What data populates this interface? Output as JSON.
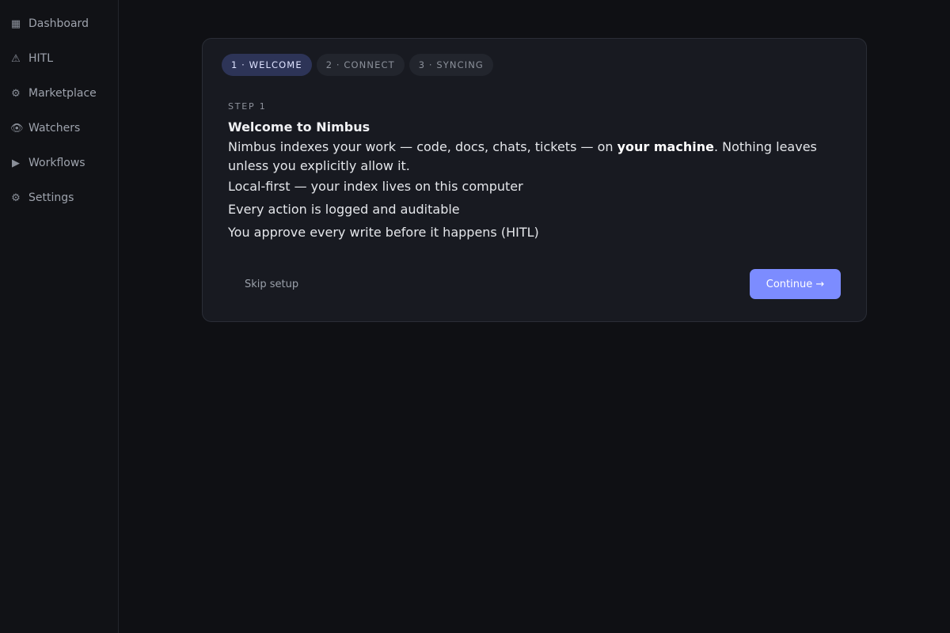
{
  "sidebar": {
    "items": [
      {
        "icon": "▦",
        "label": "Dashboard"
      },
      {
        "icon": "⚠",
        "label": "HITL"
      },
      {
        "icon": "⚙",
        "label": "Marketplace"
      },
      {
        "icon": "👁",
        "label": "Watchers"
      },
      {
        "icon": "▶",
        "label": "Workflows"
      },
      {
        "icon": "⚙",
        "label": "Settings"
      }
    ]
  },
  "onboarding": {
    "steps": [
      {
        "label": "1 · WELCOME",
        "active": true
      },
      {
        "label": "2 · CONNECT",
        "active": false
      },
      {
        "label": "3 · SYNCING",
        "active": false
      }
    ],
    "eyebrow": "STEP 1",
    "title": "Welcome to Nimbus",
    "description": {
      "before": "Nimbus indexes your work — code, docs, chats, tickets — on ",
      "emphasis": "your machine",
      "after": ". Nothing leaves unless you explicitly allow it."
    },
    "bullets": [
      "Local-first — your index lives on this computer",
      "Every action is logged and auditable",
      "You approve every write before it happens (HITL)"
    ],
    "skip_label": "Skip setup",
    "continue_label": "Continue →"
  },
  "colors": {
    "accent": "#7c8cff",
    "active_step_bg": "#2d3457",
    "background": "#0f1014",
    "card": "#181a21"
  }
}
